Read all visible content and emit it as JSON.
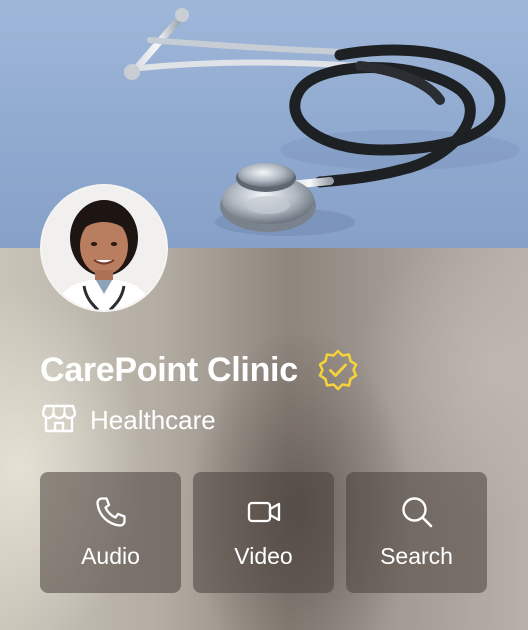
{
  "profile": {
    "name": "CarePoint Clinic",
    "verified": true,
    "category": "Healthcare",
    "category_icon": "storefront-icon",
    "verified_icon": "verified-badge-icon",
    "accent_color": "#f5d23a"
  },
  "cover": {
    "image": "stethoscope-photo",
    "background_color": "#8fa9cf"
  },
  "avatar": {
    "image": "doctor-portrait-photo"
  },
  "actions": [
    {
      "label": "Audio",
      "icon": "phone-icon"
    },
    {
      "label": "Video",
      "icon": "video-camera-icon"
    },
    {
      "label": "Search",
      "icon": "search-icon"
    }
  ]
}
